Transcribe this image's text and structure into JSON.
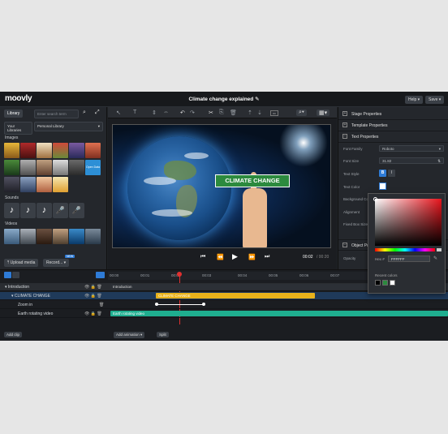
{
  "app": {
    "logo": "moovly",
    "title": "Climate change explained",
    "help_label": "Help ▾",
    "save_label": "Save ▾"
  },
  "library": {
    "tab": "Library",
    "search_placeholder": "Enter search term",
    "dropdown_your": "Your Libraries",
    "dropdown_personal": "Personal Library",
    "images_label": "Images",
    "sounds_label": "Sounds",
    "videos_label": "Videos",
    "upload_label": "Upload media",
    "record_label": "Record...",
    "new_badge": "NEW",
    "open_data_text": "Open Data"
  },
  "stage": {
    "label": "CLIMATE CHANGE",
    "time_current": "00:02",
    "time_total": "/ 00:20"
  },
  "properties": {
    "stage": "Stage Properties",
    "template": "Template Properties",
    "text": "Text Properties",
    "object": "Object Pro",
    "font_family_label": "Font Family",
    "font_family_value": "Roboto",
    "font_size_label": "Font Size",
    "font_size_value": "31.82",
    "text_style_label": "Text Style",
    "bold": "B",
    "italic": "I",
    "text_color_label": "Text Color",
    "background_color_label": "Background Col",
    "alignment_label": "Alignment",
    "fixed_box_label": "Fixed Box Size",
    "opacity_label": "Opacity"
  },
  "picker": {
    "hex_label": "Hex #",
    "hex_value": "FFFFFF",
    "recent_label": "Recent colors",
    "recent": [
      "#000000",
      "#2c8a3e",
      "#ffffff"
    ]
  },
  "timeline": {
    "ticks": [
      "00:00",
      "00:01",
      "00:02",
      "00:03",
      "00:04",
      "00:05",
      "00:06",
      "00:07"
    ],
    "tracks": [
      {
        "name": "Introduction",
        "bar": "Introduction"
      },
      {
        "name": "CLIMATE CHANGE",
        "bar": "CLIMATE CHANGE"
      },
      {
        "name": "Zoom in",
        "bar": ""
      },
      {
        "name": "Earth rotating video",
        "bar": "Earth rotating video"
      }
    ],
    "add_clip": "Add clip",
    "add_animation": "Add animation ▾",
    "split": "Split"
  },
  "colors": {
    "accent": "#2e7bd6",
    "label_green": "#2c8a3e",
    "bar_yellow": "#e8b21b",
    "bar_teal": "#1fae8f"
  }
}
